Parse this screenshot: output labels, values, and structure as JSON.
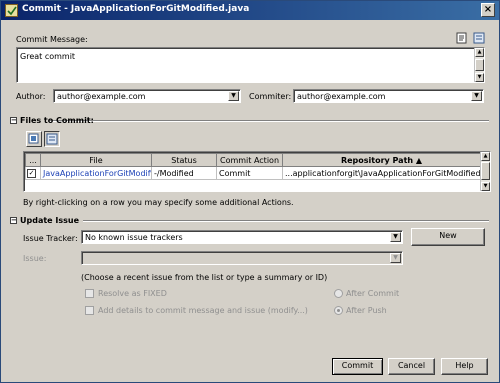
{
  "window": {
    "title": "Commit - JavaApplicationForGitModified.java",
    "close_glyph": "×"
  },
  "commit": {
    "message_label": "Commit Message:",
    "message": "Great commit",
    "author_label": "Author:",
    "author": "author@example.com",
    "committer_label": "Commiter:",
    "committer": "author@example.com"
  },
  "files_section": {
    "title": "Files to Commit:",
    "collapse_glyph": "−",
    "columns": [
      "...",
      "File",
      "Status",
      "Commit Action",
      "Repository Path ▲"
    ],
    "rows": [
      {
        "checked": "✓",
        "file": "JavaApplicationForGitModified.java",
        "status": "-/Modified",
        "action": "Commit",
        "path": "...applicationforgit\\JavaApplicationForGitModified.java"
      }
    ],
    "hint": "By right-clicking on a row you may specify some additional Actions."
  },
  "issue_section": {
    "title": "Update Issue",
    "collapse_glyph": "−",
    "tracker_label": "Issue Tracker:",
    "tracker_value": "No known issue trackers",
    "new_button": "New",
    "issue_label": "Issue:",
    "issue_value": "",
    "hint": "(Choose a recent issue from the list or type a summary or ID)",
    "resolve_label": "Resolve as FIXED",
    "add_details_label": "Add details to commit message and issue  (modify...)",
    "after_commit_label": "After Commit",
    "after_push_label": "After Push"
  },
  "buttons": {
    "commit": "Commit",
    "cancel": "Cancel",
    "help": "Help"
  },
  "colors": {
    "title_start": "#0a246a",
    "title_end": "#3a6ea5",
    "face": "#d4d0c8",
    "link": "#1a3fb5"
  }
}
